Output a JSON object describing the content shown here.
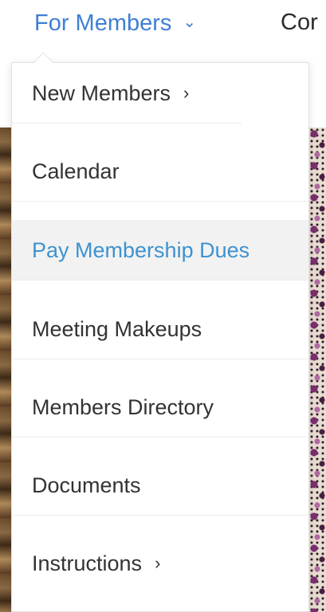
{
  "nav": {
    "for_members_label": "For Members",
    "for_members_chevron": "⌄",
    "next_label_partial": "Cor"
  },
  "dropdown": {
    "items": [
      {
        "label": "New Members",
        "has_submenu": true,
        "arrow": "›"
      },
      {
        "label": "Calendar",
        "has_submenu": false
      },
      {
        "label": "Pay Membership Dues",
        "has_submenu": false,
        "active": true
      },
      {
        "label": "Meeting Makeups",
        "has_submenu": false
      },
      {
        "label": "Members Directory",
        "has_submenu": false
      },
      {
        "label": "Documents",
        "has_submenu": false
      },
      {
        "label": "Instructions",
        "has_submenu": true,
        "arrow": "›"
      }
    ]
  },
  "colors": {
    "nav_active": "#3f7fd3",
    "item_active_text": "#3e92cf",
    "item_active_bg": "#f2f2f2",
    "item_text": "#333333"
  }
}
